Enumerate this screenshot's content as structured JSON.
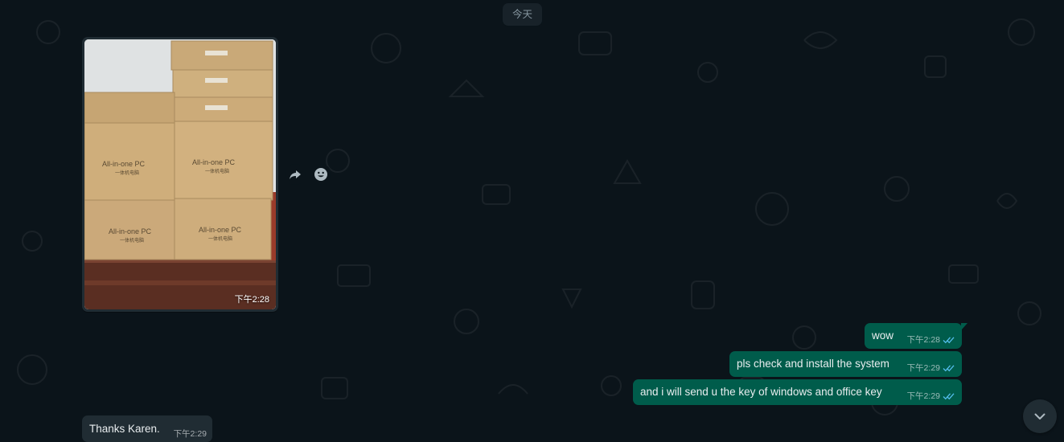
{
  "chat": {
    "date_divider": "今天",
    "image_message": {
      "time": "下午2:28",
      "box_text": "All-in-one PC",
      "box_subtext": "一体机电脑"
    },
    "outgoing": [
      {
        "text": "wow",
        "time": "下午2:28",
        "status_icon": "double-check-icon"
      },
      {
        "text": "pls check and install the system",
        "time": "下午2:29",
        "status_icon": "double-check-icon"
      },
      {
        "text": "and i will send u the key of windows and office key",
        "time": "下午2:29",
        "status_icon": "double-check-icon"
      }
    ],
    "incoming": [
      {
        "text": "Thanks Karen.",
        "time": "下午2:29"
      }
    ]
  },
  "icons": {
    "forward": "forward-icon",
    "react": "emoji-icon",
    "scroll": "chevron-down-icon"
  },
  "colors": {
    "background": "#0b141a",
    "incoming_bubble": "#202c33",
    "outgoing_bubble": "#005c4b",
    "read_ticks": "#53bdeb",
    "text": "#e9edef"
  }
}
